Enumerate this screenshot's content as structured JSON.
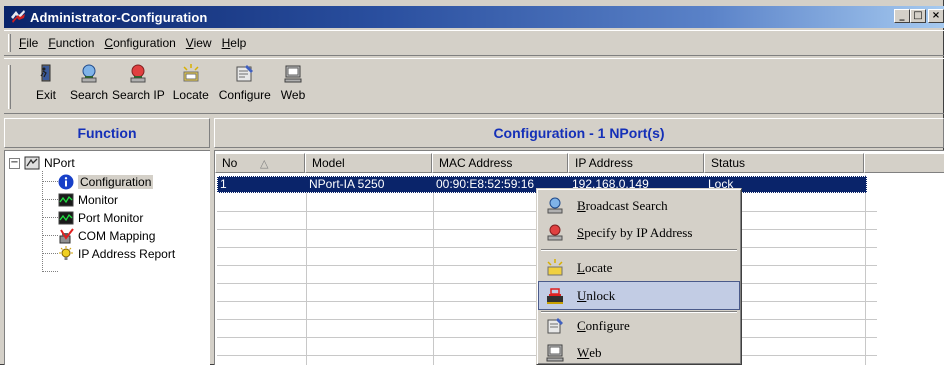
{
  "window": {
    "title": "Administrator-Configuration",
    "controls": [
      "_",
      "□",
      "×"
    ]
  },
  "menubar": {
    "items": [
      {
        "underline": "F",
        "rest": "ile"
      },
      {
        "underline": "F",
        "rest": "unction"
      },
      {
        "underline": "C",
        "rest": "onfiguration"
      },
      {
        "underline": "V",
        "rest": "iew"
      },
      {
        "underline": "H",
        "rest": "elp"
      }
    ]
  },
  "toolbar": {
    "items": [
      {
        "label": "Exit",
        "icon": "exit-icon"
      },
      {
        "label": "Search",
        "icon": "search-icon"
      },
      {
        "label": "Search IP",
        "icon": "search-ip-icon"
      },
      {
        "label": "Locate",
        "icon": "locate-icon"
      },
      {
        "label": "Configure",
        "icon": "configure-icon"
      },
      {
        "label": "Web",
        "icon": "web-icon"
      }
    ]
  },
  "left_panel": {
    "header": "Function",
    "tree": {
      "root": {
        "label": "NPort",
        "expander": "−",
        "icon": "nport-icon"
      },
      "children": [
        {
          "label": "Configuration",
          "icon": "info-icon",
          "selected": true
        },
        {
          "label": "Monitor",
          "icon": "monitor-icon"
        },
        {
          "label": "Port Monitor",
          "icon": "port-monitor-icon"
        },
        {
          "label": "COM Mapping",
          "icon": "com-mapping-icon"
        },
        {
          "label": "IP Address Report",
          "icon": "ip-report-icon"
        }
      ]
    }
  },
  "right_panel": {
    "header": "Configuration - 1 NPort(s)",
    "columns": [
      "No",
      "Model",
      "MAC Address",
      "IP Address",
      "Status"
    ],
    "sort_indicator": "△",
    "rows": [
      {
        "no": "1",
        "model": "NPort-IA 5250",
        "mac": "00:90:E8:52:59:16",
        "ip": "192.168.0.149",
        "status": "Lock"
      }
    ]
  },
  "context_menu": {
    "items": [
      {
        "underline": "B",
        "rest": "roadcast Search",
        "icon": "broadcast-search-icon"
      },
      {
        "underline": "S",
        "rest": "pecify by IP Address",
        "icon": "specify-ip-icon"
      },
      {
        "underline": "L",
        "rest": "ocate",
        "icon": "locate-icon"
      },
      {
        "underline": "U",
        "rest": "nlock",
        "icon": "unlock-icon",
        "highlighted": true
      },
      {
        "underline": "C",
        "rest": "onfigure",
        "icon": "configure-icon"
      },
      {
        "underline": "W",
        "rest": "eb",
        "icon": "web-icon"
      }
    ]
  },
  "colors": {
    "title_bar": "#0a246a",
    "panel_header_text": "#1530b8",
    "selection": "#0a246a",
    "face": "#d4d0c8"
  }
}
